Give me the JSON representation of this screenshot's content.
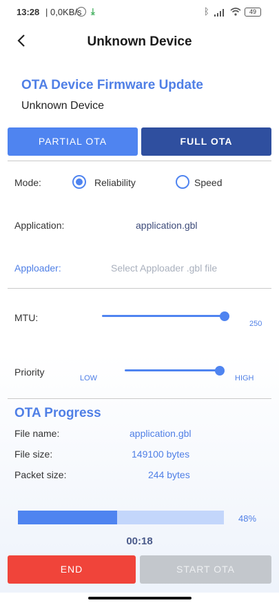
{
  "status_bar": {
    "time": "13:28",
    "net_speed": "| 0,0KB/s",
    "battery": "49"
  },
  "header": {
    "title": "Unknown Device"
  },
  "ota": {
    "section_title": "OTA Device Firmware Update",
    "device_name": "Unknown Device",
    "tabs": [
      {
        "label": "PARTIAL OTA",
        "active": false
      },
      {
        "label": "FULL OTA",
        "active": true
      }
    ],
    "mode": {
      "label": "Mode:",
      "options": [
        "Reliability",
        "Speed"
      ],
      "selected": "Reliability"
    },
    "application": {
      "label": "Application:",
      "value": "application.gbl"
    },
    "apploader": {
      "label": "Apploader:",
      "placeholder": "Select Apploader .gbl file"
    },
    "mtu": {
      "label": "MTU:",
      "value": "250",
      "fraction": 1.0
    },
    "priority": {
      "label": "Priority",
      "low_label": "LOW",
      "high_label": "HIGH",
      "fraction": 1.0
    }
  },
  "progress": {
    "title": "OTA Progress",
    "rows": [
      {
        "label": "File name:",
        "value": "application.gbl"
      },
      {
        "label": "File size:",
        "value": "149100 bytes"
      },
      {
        "label": "Packet size:",
        "value": "244 bytes"
      }
    ],
    "percent_text": "48%",
    "percent": 48,
    "elapsed": "00:18"
  },
  "buttons": {
    "end": "END",
    "start": "START OTA"
  },
  "colors": {
    "accent": "#4f84f0",
    "accent_dark": "#2f4f9f",
    "danger": "#f0443a",
    "disabled": "#c3c7cc"
  }
}
